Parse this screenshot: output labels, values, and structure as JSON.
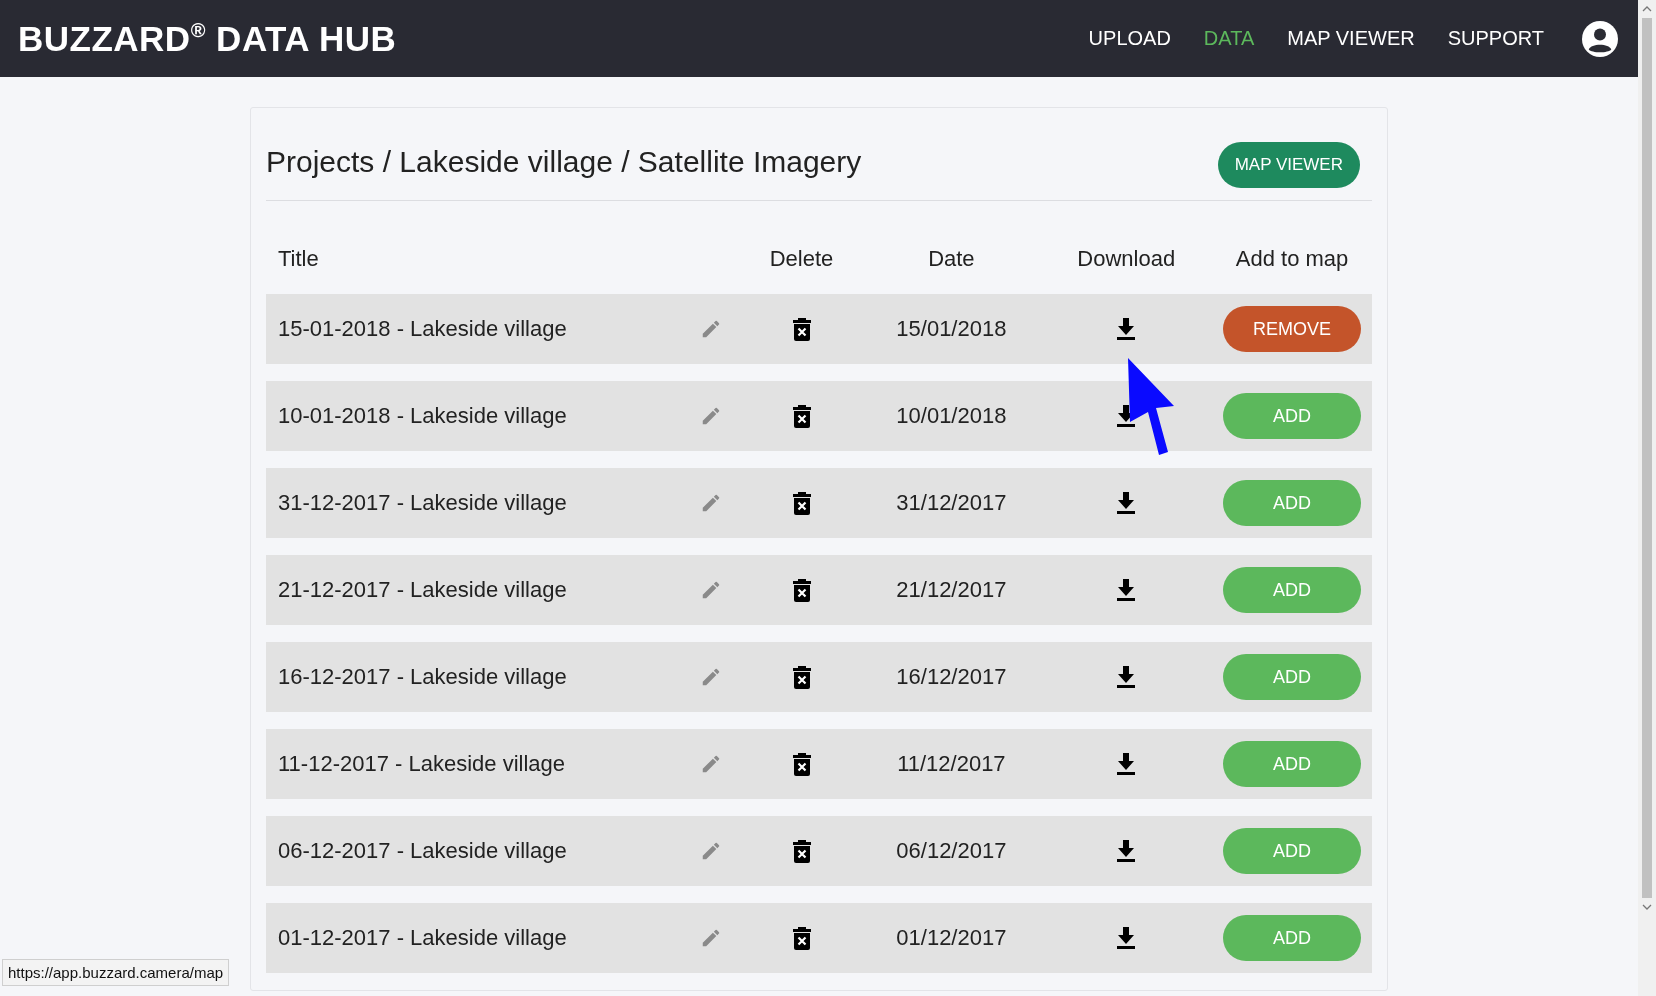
{
  "header": {
    "logo": "BUZZARD$^{®}$ DATA HUB",
    "nav": [
      {
        "label": "UPLOAD",
        "selected": false
      },
      {
        "label": "DATA",
        "selected": true
      },
      {
        "label": "MAP VIEWER",
        "selected": false
      },
      {
        "label": "SUPPORT",
        "selected": false
      }
    ]
  },
  "breadcrumb": "Projects / Lakeside village / Satellite Imagery",
  "map_viewer_button": "MAP VIEWER",
  "table": {
    "columns": [
      "Title",
      "Delete",
      "Date",
      "Download",
      "Add to map"
    ],
    "rows": [
      {
        "title": "15-01-2018 - Lakeside village",
        "date": "15/01/2018",
        "on_map": true,
        "action": "REMOVE"
      },
      {
        "title": "10-01-2018 - Lakeside village",
        "date": "10/01/2018",
        "on_map": false,
        "action": "ADD"
      },
      {
        "title": "31-12-2017 - Lakeside village",
        "date": "31/12/2017",
        "on_map": false,
        "action": "ADD"
      },
      {
        "title": "21-12-2017 - Lakeside village",
        "date": "21/12/2017",
        "on_map": false,
        "action": "ADD"
      },
      {
        "title": "16-12-2017 - Lakeside village",
        "date": "16/12/2017",
        "on_map": false,
        "action": "ADD"
      },
      {
        "title": "11-12-2017 - Lakeside village",
        "date": "11/12/2017",
        "on_map": false,
        "action": "ADD"
      },
      {
        "title": "06-12-2017 - Lakeside village",
        "date": "06/12/2017",
        "on_map": false,
        "action": "ADD"
      },
      {
        "title": "01-12-2017 - Lakeside village",
        "date": "01/12/2017",
        "on_map": false,
        "action": "ADD"
      }
    ]
  },
  "status_bar": "https://app.buzzard.camera/map"
}
